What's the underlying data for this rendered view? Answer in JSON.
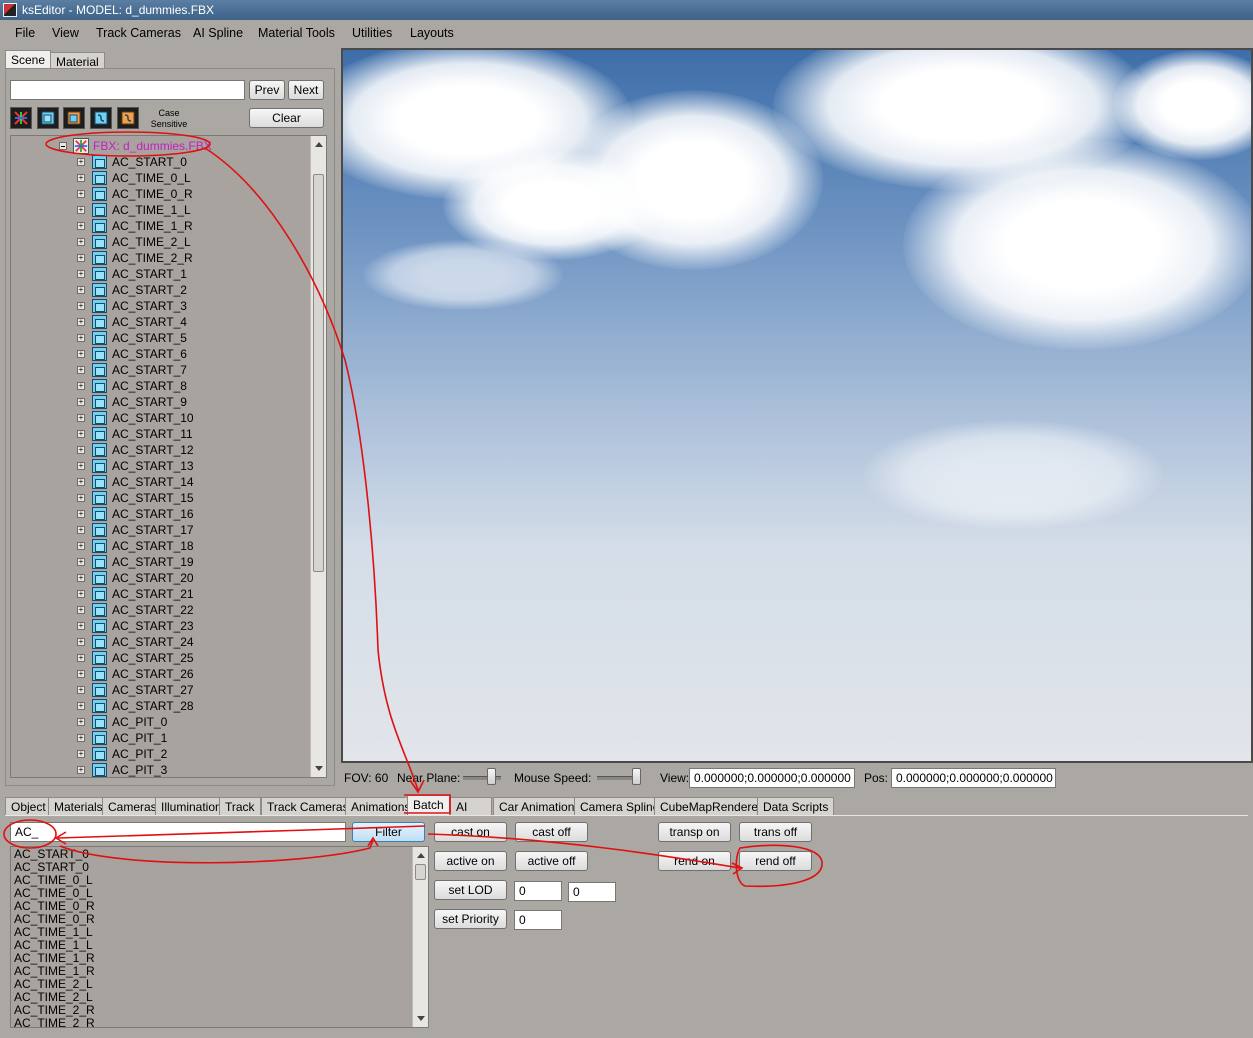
{
  "window": {
    "title": "ksEditor - MODEL: d_dummies.FBX"
  },
  "menu": [
    "File",
    "View",
    "Track Cameras",
    "AI Spline",
    "Material Tools",
    "Utilities",
    "Layouts"
  ],
  "left_tabs": [
    "Scene",
    "Material"
  ],
  "search": {
    "value": "",
    "prev_label": "Prev",
    "next_label": "Next",
    "clear_label": "Clear",
    "case_line1": "Case",
    "case_line2": "Sensitive"
  },
  "tree": {
    "root": "FBX: d_dummies.FBX",
    "items": [
      "AC_START_0",
      "AC_TIME_0_L",
      "AC_TIME_0_R",
      "AC_TIME_1_L",
      "AC_TIME_1_R",
      "AC_TIME_2_L",
      "AC_TIME_2_R",
      "AC_START_1",
      "AC_START_2",
      "AC_START_3",
      "AC_START_4",
      "AC_START_5",
      "AC_START_6",
      "AC_START_7",
      "AC_START_8",
      "AC_START_9",
      "AC_START_10",
      "AC_START_11",
      "AC_START_12",
      "AC_START_13",
      "AC_START_14",
      "AC_START_15",
      "AC_START_16",
      "AC_START_17",
      "AC_START_18",
      "AC_START_19",
      "AC_START_20",
      "AC_START_21",
      "AC_START_22",
      "AC_START_23",
      "AC_START_24",
      "AC_START_25",
      "AC_START_26",
      "AC_START_27",
      "AC_START_28",
      "AC_PIT_0",
      "AC_PIT_1",
      "AC_PIT_2",
      "AC_PIT_3"
    ]
  },
  "status": {
    "fov": "FOV: 60",
    "near_plane_label": "Near Plane:",
    "mouse_speed_label": "Mouse Speed:",
    "view_label": "View:",
    "view_value": "0.000000;0.000000;0.000000",
    "pos_label": "Pos:",
    "pos_value": "0.000000;0.000000;0.000000"
  },
  "bottom_tabs": [
    "Object",
    "Materials",
    "Cameras",
    "Illumination",
    "Track",
    "Track Cameras",
    "Animations",
    "Batch",
    "AI",
    "Car Animations",
    "Camera Spline",
    "CubeMapRenderer",
    "Data Scripts"
  ],
  "batch": {
    "filter_value": "AC_",
    "filter_label": "Filter",
    "cast_on": "cast on",
    "cast_off": "cast off",
    "transp_on": "transp on",
    "trans_off": "trans off",
    "active_on": "active on",
    "active_off": "active off",
    "rend_on": "rend on",
    "rend_off": "rend off",
    "set_lod": "set LOD",
    "lod_a": "0",
    "lod_b": "0",
    "set_priority": "set Priority",
    "priority": "0",
    "list": [
      "AC_START_0",
      "AC_START_0",
      "AC_TIME_0_L",
      "AC_TIME_0_L",
      "AC_TIME_0_R",
      "AC_TIME_0_R",
      "AC_TIME_1_L",
      "AC_TIME_1_L",
      "AC_TIME_1_R",
      "AC_TIME_1_R",
      "AC_TIME_2_L",
      "AC_TIME_2_L",
      "AC_TIME_2_R",
      "AC_TIME_2_R"
    ]
  },
  "colors": {
    "annotation": "#e01010",
    "root_label": "#c31fc3",
    "node_icon": "#6fd0f3"
  }
}
